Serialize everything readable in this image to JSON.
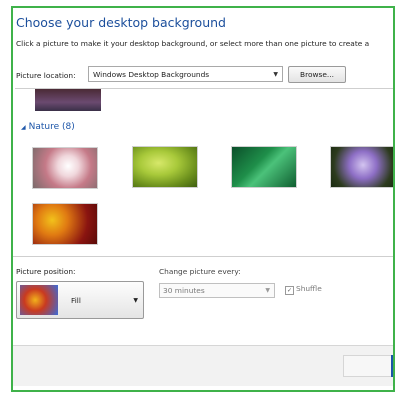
{
  "header": {
    "title": "Choose your desktop background",
    "subtitle": "Click a picture to make it your desktop background, or select more than one picture to create a"
  },
  "location": {
    "label": "Picture location:",
    "value": "Windows Desktop Backgrounds",
    "browse_label": "Browse..."
  },
  "gallery": {
    "group_label": "Nature (8)"
  },
  "position": {
    "label": "Picture position:",
    "value": "Fill"
  },
  "change": {
    "label": "Change picture every:",
    "value": "30 minutes"
  },
  "shuffle": {
    "label": "Shuffle",
    "checked_mark": "✓"
  },
  "colors": {
    "title": "#1c4f9c",
    "frame_border": "#3fb24a",
    "group_header": "#1c55a8"
  }
}
